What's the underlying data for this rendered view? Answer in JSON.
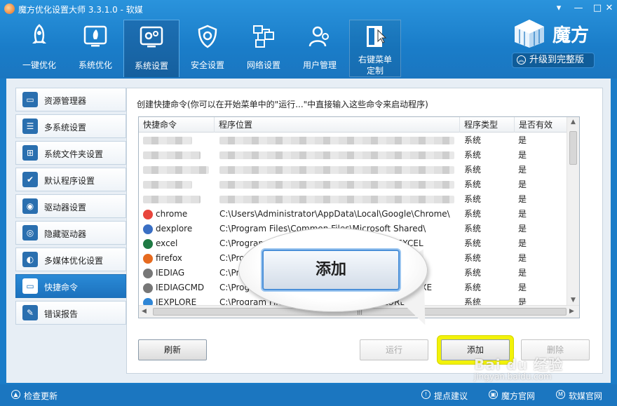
{
  "window": {
    "title": "魔方优化设置大师 3.3.1.0 - 软媒"
  },
  "nav": [
    {
      "label": "一键优化",
      "icon": "rocket-icon"
    },
    {
      "label": "系统优化",
      "icon": "rocket-monitor-icon"
    },
    {
      "label": "系统设置",
      "icon": "gears-icon",
      "active": true
    },
    {
      "label": "安全设置",
      "icon": "shield-icon"
    },
    {
      "label": "网络设置",
      "icon": "network-icon"
    },
    {
      "label": "用户管理",
      "icon": "users-icon"
    },
    {
      "label_line1": "右键菜单",
      "label_line2": "定制",
      "icon": "context-menu-icon"
    }
  ],
  "brand": {
    "name": "魔方",
    "upgrade": "升级到完整版"
  },
  "sidebar": [
    {
      "label": "资源管理器",
      "icon": "explorer-icon"
    },
    {
      "label": "多系统设置",
      "icon": "multi-system-icon"
    },
    {
      "label": "系统文件夹设置",
      "icon": "windows-folder-icon"
    },
    {
      "label": "默认程序设置",
      "icon": "default-program-icon"
    },
    {
      "label": "驱动器设置",
      "icon": "drive-icon"
    },
    {
      "label": "隐藏驱动器",
      "icon": "hidden-drive-icon"
    },
    {
      "label": "多媒体优化设置",
      "icon": "multimedia-icon"
    },
    {
      "label": "快捷命令",
      "icon": "shortcut-icon",
      "active": true
    },
    {
      "label": "错误报告",
      "icon": "error-report-icon"
    }
  ],
  "content": {
    "description": "创建快捷命令(你可以在开始菜单中的\"运行...\"中直接输入这些命令来启动程序)",
    "columns": [
      "快捷命令",
      "程序位置",
      "程序类型",
      "是否有效"
    ],
    "rows": [
      {
        "name": "",
        "path": "",
        "type": "系统",
        "valid": "是",
        "blurred": true
      },
      {
        "name": "",
        "path": "",
        "type": "系统",
        "valid": "是",
        "blurred": true
      },
      {
        "name": "",
        "path": "",
        "type": "系统",
        "valid": "是",
        "blurred": true
      },
      {
        "name": "",
        "path": "",
        "type": "系统",
        "valid": "是",
        "blurred": true
      },
      {
        "name": "",
        "path": "",
        "type": "系统",
        "valid": "是",
        "blurred": true
      },
      {
        "name": "chrome",
        "path": "C:\\Users\\Administrator\\AppData\\Local\\Google\\Chrome\\",
        "type": "系统",
        "valid": "是",
        "icon_color": "#e8453c"
      },
      {
        "name": "dexplore",
        "path": "C:\\Program Files\\Common Files\\Microsoft Shared\\",
        "type": "系统",
        "valid": "是",
        "icon_color": "#3a6fc4"
      },
      {
        "name": "excel",
        "path": "C:\\Program Files\\Microsoft Office\\Office16\\EXCEL",
        "type": "系统",
        "valid": "是",
        "icon_color": "#1f7a44"
      },
      {
        "name": "firefox",
        "path": "C:\\Program Files\\Mozilla Firefox\\firefox.exe",
        "type": "系统",
        "valid": "是",
        "icon_color": "#e66a1f"
      },
      {
        "name": "IEDIAG",
        "path": "C:\\Program Files\\Internet Explorer\\IEDIAG.EXE",
        "type": "系统",
        "valid": "是",
        "icon_color": "#777777"
      },
      {
        "name": "IEDIAGCMD",
        "path": "C:\\Program Files\\Internet Explorer\\IEDIAGCMD.EXE",
        "type": "系统",
        "valid": "是",
        "icon_color": "#777777"
      },
      {
        "name": "IEXPLORE",
        "path": "C:\\Program Files\\Internet Explorer\\IEXPLORE.EXE",
        "type": "系统",
        "valid": "是",
        "icon_color": "#2f86d6"
      }
    ],
    "buttons": {
      "refresh": "刷新",
      "run": "运行",
      "add": "添加",
      "delete": "删除"
    },
    "callout": "添加"
  },
  "statusbar": {
    "check_update": "检查更新",
    "feedback": "提点建议",
    "site": "魔方官网",
    "ruanmei": "软媒官网"
  },
  "watermark": {
    "text": "Bai du 经验",
    "url": "jingyan.baidu.com"
  },
  "colors": {
    "accent": "#1b76c0",
    "highlight": "#f2f20a"
  }
}
